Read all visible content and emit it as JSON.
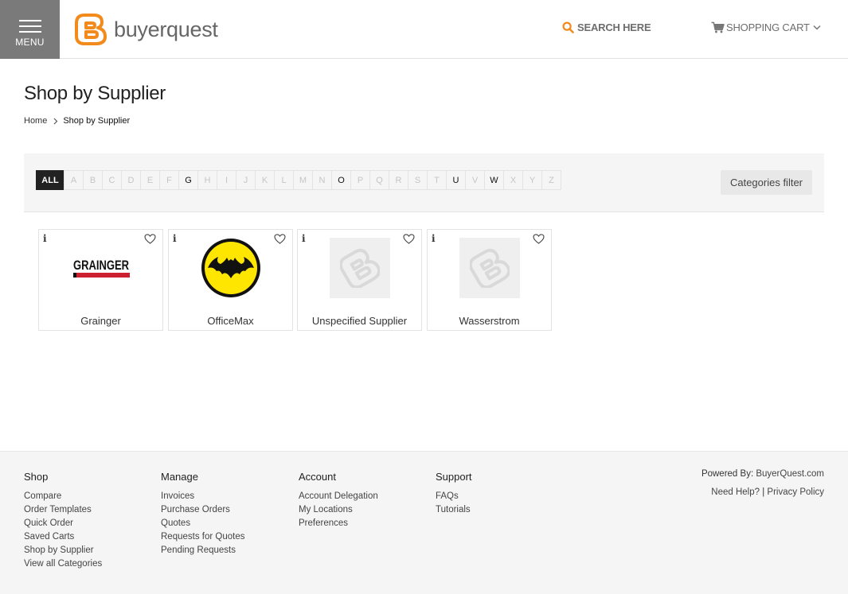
{
  "header": {
    "menu_label": "MENU",
    "logo_text": "buyerquest",
    "search_label": "SEARCH HERE",
    "cart_label": "SHOPPING CART",
    "accent_color": "#f28a1c"
  },
  "page": {
    "title": "Shop by Supplier",
    "breadcrumb": {
      "home": "Home",
      "current": "Shop by Supplier"
    }
  },
  "filter": {
    "all_label": "ALL",
    "letters": [
      "A",
      "B",
      "C",
      "D",
      "E",
      "F",
      "G",
      "H",
      "I",
      "J",
      "K",
      "L",
      "M",
      "N",
      "O",
      "P",
      "Q",
      "R",
      "S",
      "T",
      "U",
      "V",
      "W",
      "X",
      "Y",
      "Z"
    ],
    "active_letters": [
      "G",
      "O",
      "U",
      "W"
    ],
    "categories_filter_label": "Categories filter"
  },
  "suppliers": [
    {
      "name": "Grainger",
      "image": "grainger-logo"
    },
    {
      "name": "OfficeMax",
      "image": "bat-logo"
    },
    {
      "name": "Unspecified Supplier",
      "image": "placeholder-logo"
    },
    {
      "name": "Wasserstrom",
      "image": "placeholder-logo"
    }
  ],
  "supplier_icons": {
    "info": "i",
    "favorite": "heart-icon"
  },
  "grainger_logo_text": "GRAINGER",
  "footer": {
    "columns": [
      {
        "heading": "Shop",
        "links": [
          "Compare",
          "Order Templates",
          "Quick Order",
          "Saved Carts",
          "Shop by Supplier",
          "View all Categories"
        ]
      },
      {
        "heading": "Manage",
        "links": [
          "Invoices",
          "Purchase Orders",
          "Quotes",
          "Requests for Quotes",
          "Pending Requests"
        ]
      },
      {
        "heading": "Account",
        "links": [
          "Account Delegation",
          "My Locations",
          "Preferences"
        ]
      },
      {
        "heading": "Support",
        "links": [
          "FAQs",
          "Tutorials"
        ]
      }
    ],
    "powered_by": "Powered By:",
    "powered_link": "BuyerQuest.com",
    "need_help": "Need Help?",
    "divider": "|",
    "privacy": "Privacy Policy"
  }
}
